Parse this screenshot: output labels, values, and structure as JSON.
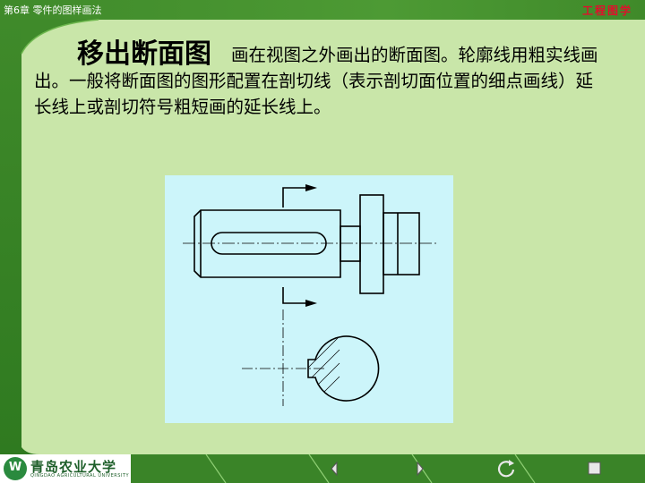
{
  "header": {
    "chapter": "第6章  零件的图样画法",
    "brand": "工程图学"
  },
  "content": {
    "title": "移出断面图",
    "body": "画在视图之外画出的断面图。轮廓线用粗实线画出。一般将断面图的图形配置在剖切线（表示剖切面位置的细点画线）延长线上或剖切符号粗短画的延长线上。"
  },
  "footer": {
    "logo_text": "青岛农业大学",
    "logo_sub": "QINGDAO AGRICULTURAL UNIVERSITY",
    "nav": [
      "previous-icon",
      "next-icon",
      "return-icon",
      "stop-icon"
    ]
  },
  "colors": {
    "header_bg": "#4d9a34",
    "page_bg": "#c9e6a9",
    "figure_bg": "#ccf5fa",
    "brand_text": "#e0102c"
  }
}
